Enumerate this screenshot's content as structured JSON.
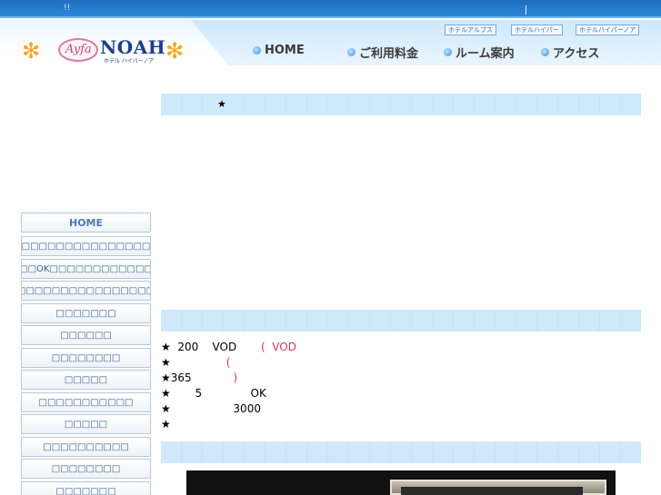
{
  "top_bar": {
    "marks": "!!"
  },
  "logo": {
    "script": "Ayfa",
    "name": "NOAH",
    "subtitle": "ホテル ハイパーノア"
  },
  "hotel_links": [
    "ホテルアルプス",
    "ホテルハイパー",
    "ホテルハイパーノア"
  ],
  "nav": [
    "HOME",
    "ご利用料金",
    "ルーム案内",
    "アクセス"
  ],
  "section_band_mark": "★",
  "sidebar": [
    "HOME",
    "□□□□□□□□□□□□□□□□□□□□□",
    "□□□□□OK□□□□□□□□□□□□□□□",
    "□□□□□□□□□□□□□□□□□□□□",
    "□□□□□□□",
    "□□□□□□",
    "□□□□□□□□",
    "□□□□□",
    "□□□□□□□□□□□",
    "□□□□□",
    "□□□□□□□□□□",
    "□□□□□□□□",
    "□□□□□□□"
  ],
  "features": [
    {
      "text": "★  200    VOD       ",
      "pink": "(  VOD"
    },
    {
      "text": "★                ",
      "pink": "("
    },
    {
      "text": "★365            ",
      "pink": ")"
    },
    {
      "text": "★       5              OK",
      "pink": ""
    },
    {
      "text": "★                  3000",
      "pink": ""
    },
    {
      "text": "★",
      "pink": ""
    }
  ]
}
